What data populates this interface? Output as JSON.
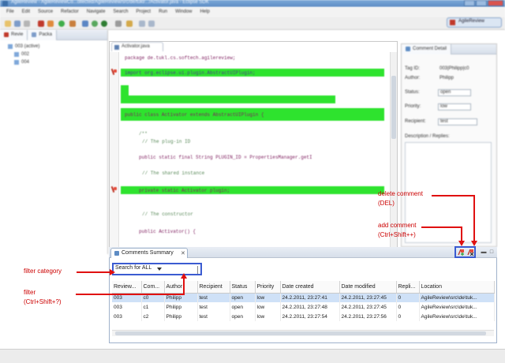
{
  "window": {
    "title": "AgileReview - AgileReviewCo...ollected/AgileReview/src/de/tukl/.../Activator.java - Eclipse SDK"
  },
  "menu": [
    "File",
    "Edit",
    "Source",
    "Refactor",
    "Navigate",
    "Search",
    "Project",
    "Run",
    "Window",
    "Help"
  ],
  "perspective": {
    "label": "AgileReview"
  },
  "left_pane": {
    "tabs": [
      "Revie",
      "Packa"
    ],
    "tree": [
      "003 (active)",
      "002",
      "004"
    ]
  },
  "editor": {
    "tab": "Activator.java",
    "lines": [
      "package de.tukl.cs.softech.agilereview;",
      "import org.eclipse.ui.plugin.AbstractUIPlugin;",
      "/**",
      "public class Activator extends AbstractUIPlugin {",
      "// The plug-in ID",
      "public static final String PLUGIN_ID = PropertiesManager.getI",
      "// The shared instance",
      "private static Activator plugin;",
      "// The constructor",
      "public Activator() {"
    ]
  },
  "detail_pane": {
    "title": "Comment Detail",
    "tag_id_label": "Tag ID:",
    "tag_id_value": "003|Philipp|c0",
    "author_label": "Author:",
    "author_value": "Philipp",
    "status_label": "Status:",
    "status_value": "open",
    "priority_label": "Priority:",
    "priority_value": "low",
    "recipient_label": "Recipient:",
    "recipient_value": "test",
    "desc_label": "Description / Replies:"
  },
  "comments_view": {
    "tab_label": "Comments Summary",
    "filter_value": "Search for ALL",
    "columns": [
      "Review...",
      "Com...",
      "Author",
      "Recipient",
      "Status",
      "Priority",
      "Date created",
      "Date modified",
      "Repli...",
      "Location"
    ],
    "rows": [
      [
        "003",
        "c0",
        "Philipp",
        "test",
        "open",
        "low",
        "24.2.2011, 23:27:41",
        "24.2.2011, 23:27:45",
        "0",
        "AgileReview\\src\\de\\tuk..."
      ],
      [
        "003",
        "c1",
        "Philipp",
        "test",
        "open",
        "low",
        "24.2.2011, 23:27:48",
        "24.2.2011, 23:27:45",
        "0",
        "AgileReview\\src\\de\\tuk..."
      ],
      [
        "003",
        "c2",
        "Philipp",
        "test",
        "open",
        "low",
        "24.2.2011, 23:27:54",
        "24.2.2011, 23:27:56",
        "0",
        "AgileReview\\src\\de\\tuk..."
      ]
    ]
  },
  "annotations": {
    "delete_comment": "delete comment",
    "delete_shortcut": "(DEL)",
    "add_comment": "add comment",
    "add_shortcut": "(Ctrl+Shift++)",
    "filter_category": "filter category",
    "filter": "filter",
    "filter_shortcut": "(Ctrl+Shift+?)"
  },
  "colors": {
    "annotation": "#cc0000",
    "highlight": "#2ee32e",
    "callout_box": "#3b5bd1"
  }
}
